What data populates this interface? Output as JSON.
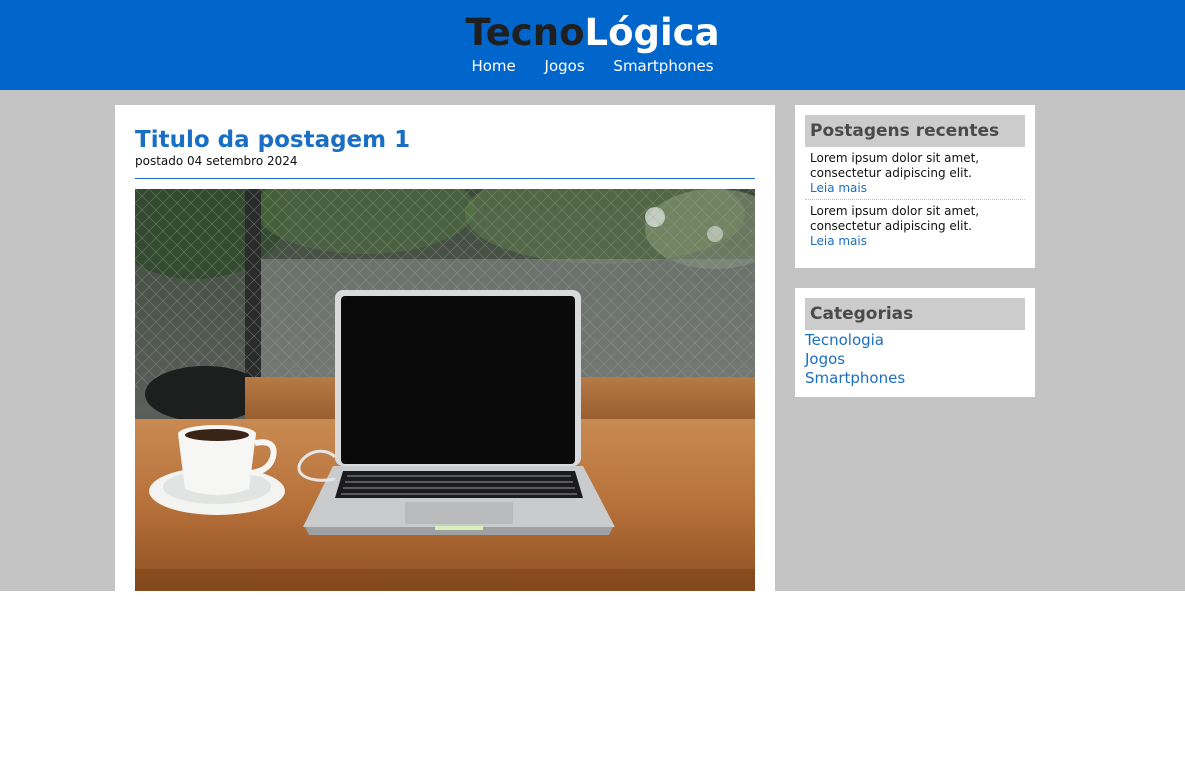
{
  "site": {
    "logo_part1": "Tecno",
    "logo_part2": "Lógica",
    "brand_color": "#0066cc"
  },
  "nav": {
    "items": [
      {
        "label": "Home"
      },
      {
        "label": "Jogos"
      },
      {
        "label": "Smartphones"
      }
    ]
  },
  "post": {
    "title": "Titulo da postagem 1",
    "date": "postado 04 setembro 2024",
    "image_subject": "laptop-and-coffee-cup-photo"
  },
  "sidebar": {
    "recent": {
      "title": "Postagens recentes",
      "items": [
        {
          "text": "Lorem ipsum dolor sit amet, consectetur adipiscing elit.",
          "link": "Leia mais"
        },
        {
          "text": "Lorem ipsum dolor sit amet, consectetur adipiscing elit.",
          "link": "Leia mais"
        }
      ]
    },
    "categories": {
      "title": "Categorias",
      "items": [
        {
          "label": "Tecnologia"
        },
        {
          "label": "Jogos"
        },
        {
          "label": "Smartphones"
        }
      ]
    }
  }
}
